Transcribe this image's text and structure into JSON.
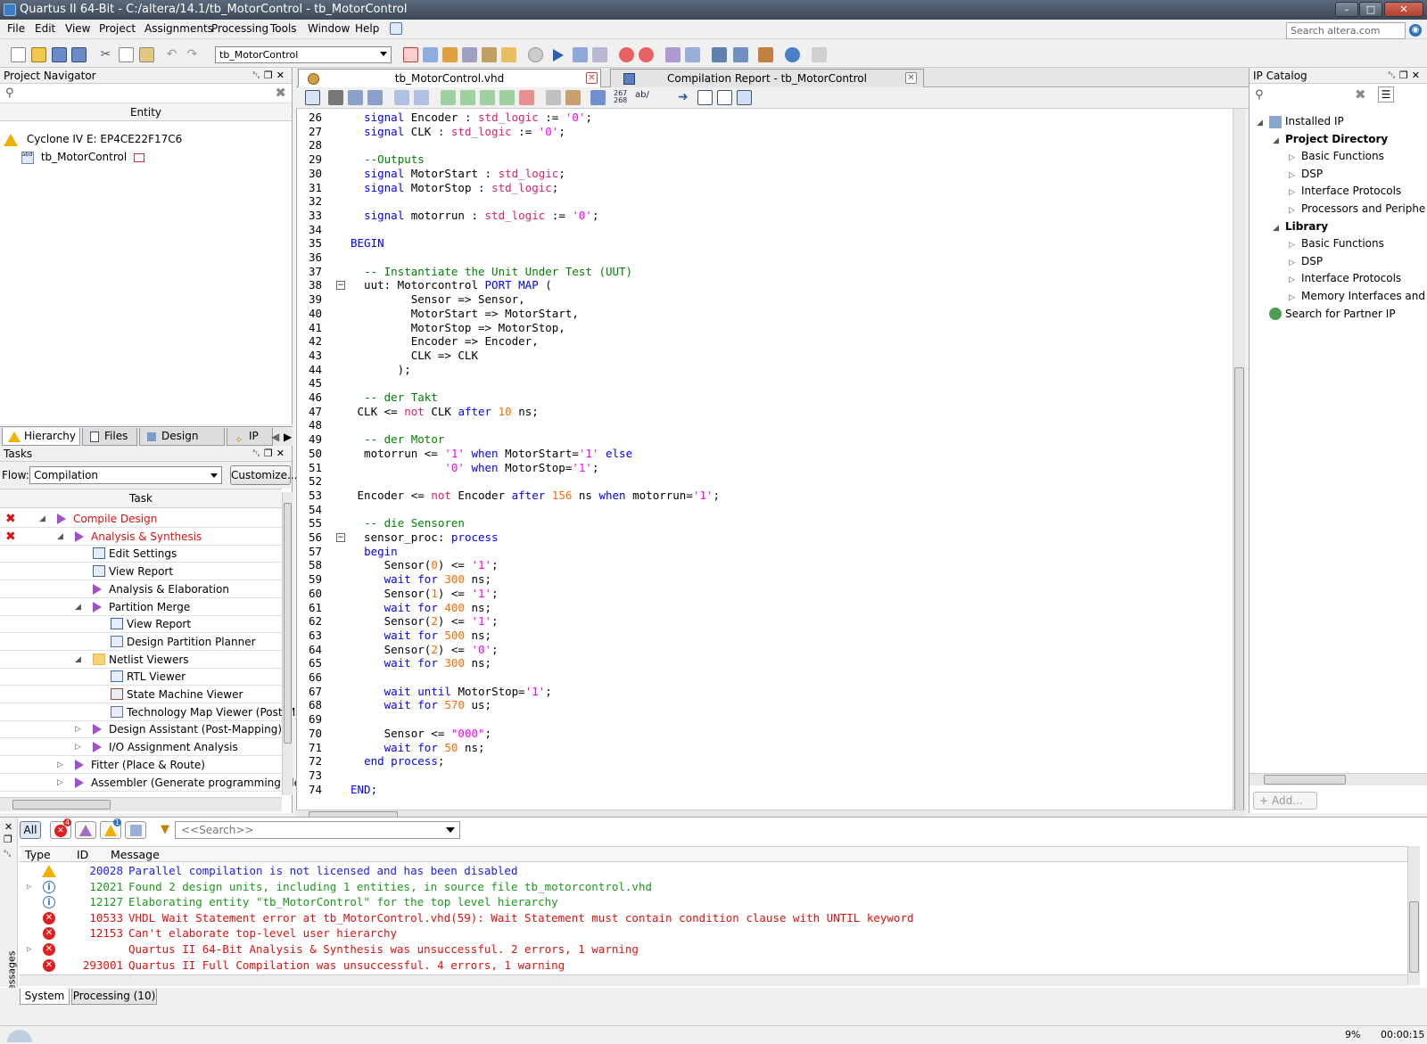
{
  "window": {
    "title": "Quartus II 64-Bit - C:/altera/14.1/tb_MotorControl - tb_MotorControl"
  },
  "menu": [
    "File",
    "Edit",
    "View",
    "Project",
    "Assignments",
    "Processing",
    "Tools",
    "Window",
    "Help"
  ],
  "web_search": {
    "placeholder": "Search altera.com"
  },
  "toolbar": {
    "entity_select": "tb_MotorControl"
  },
  "project_navigator": {
    "title": "Project Navigator",
    "column": "Entity",
    "device": "Cyclone IV E: EP4CE22F17C6",
    "entity": "tb_MotorControl",
    "tabs": [
      "Hierarchy",
      "Files",
      "Design Units",
      "IP"
    ]
  },
  "tasks": {
    "title": "Tasks",
    "flow_label": "Flow:",
    "flow_value": "Compilation",
    "customize": "Customize...",
    "column": "Task",
    "items": [
      {
        "label": "Compile Design",
        "level": 0,
        "status": "error",
        "icon": "play-icon",
        "expand": "open"
      },
      {
        "label": "Analysis & Synthesis",
        "level": 1,
        "status": "error",
        "icon": "play-icon",
        "expand": "open"
      },
      {
        "label": "Edit Settings",
        "level": 2,
        "status": "",
        "icon": "settings-icon",
        "expand": ""
      },
      {
        "label": "View Report",
        "level": 2,
        "status": "",
        "icon": "report-icon",
        "expand": ""
      },
      {
        "label": "Analysis & Elaboration",
        "level": 2,
        "status": "",
        "icon": "play-icon",
        "expand": ""
      },
      {
        "label": "Partition Merge",
        "level": 2,
        "status": "",
        "icon": "play-icon",
        "expand": "open"
      },
      {
        "label": "View Report",
        "level": 3,
        "status": "",
        "icon": "report-icon",
        "expand": ""
      },
      {
        "label": "Design Partition Planner",
        "level": 3,
        "status": "",
        "icon": "partition-icon",
        "expand": ""
      },
      {
        "label": "Netlist Viewers",
        "level": 2,
        "status": "",
        "icon": "folder-icon",
        "expand": "open"
      },
      {
        "label": "RTL Viewer",
        "level": 3,
        "status": "",
        "icon": "rtl-icon",
        "expand": ""
      },
      {
        "label": "State Machine Viewer",
        "level": 3,
        "status": "",
        "icon": "state-machine-icon",
        "expand": ""
      },
      {
        "label": "Technology Map Viewer (Post-Mappi",
        "level": 3,
        "status": "",
        "icon": "techmap-icon",
        "expand": ""
      },
      {
        "label": "Design Assistant (Post-Mapping)",
        "level": 2,
        "status": "",
        "icon": "play-icon",
        "expand": "closed"
      },
      {
        "label": "I/O Assignment Analysis",
        "level": 2,
        "status": "",
        "icon": "play-icon",
        "expand": "closed"
      },
      {
        "label": "Fitter (Place & Route)",
        "level": 1,
        "status": "",
        "icon": "play-icon",
        "expand": "closed"
      },
      {
        "label": "Assembler (Generate programming files)",
        "level": 1,
        "status": "",
        "icon": "play-icon",
        "expand": "closed"
      }
    ]
  },
  "editor": {
    "tabs": [
      {
        "label": "tb_MotorControl.vhd",
        "active": true
      },
      {
        "label": "Compilation Report - tb_MotorControl",
        "active": false
      }
    ],
    "lines": [
      {
        "n": "26",
        "t": "  signal Encoder : std_logic := '0';"
      },
      {
        "n": "27",
        "t": "  signal CLK : std_logic := '0';"
      },
      {
        "n": "28",
        "t": ""
      },
      {
        "n": "29",
        "t": "  --Outputs"
      },
      {
        "n": "30",
        "t": "  signal MotorStart : std_logic;"
      },
      {
        "n": "31",
        "t": "  signal MotorStop : std_logic;"
      },
      {
        "n": "32",
        "t": ""
      },
      {
        "n": "33",
        "t": "  signal motorrun : std_logic := '0';"
      },
      {
        "n": "34",
        "t": ""
      },
      {
        "n": "35",
        "t": "BEGIN"
      },
      {
        "n": "36",
        "t": ""
      },
      {
        "n": "37",
        "t": "  -- Instantiate the Unit Under Test (UUT)"
      },
      {
        "n": "38",
        "t": "  uut: Motorcontrol PORT MAP ("
      },
      {
        "n": "39",
        "t": "         Sensor => Sensor,"
      },
      {
        "n": "40",
        "t": "         MotorStart => MotorStart,"
      },
      {
        "n": "41",
        "t": "         MotorStop => MotorStop,"
      },
      {
        "n": "42",
        "t": "         Encoder => Encoder,"
      },
      {
        "n": "43",
        "t": "         CLK => CLK"
      },
      {
        "n": "44",
        "t": "       );"
      },
      {
        "n": "45",
        "t": ""
      },
      {
        "n": "46",
        "t": "  -- der Takt"
      },
      {
        "n": "47",
        "t": " CLK <= not CLK after 10 ns;"
      },
      {
        "n": "48",
        "t": ""
      },
      {
        "n": "49",
        "t": "  -- der Motor"
      },
      {
        "n": "50",
        "t": "  motorrun <= '1' when MotorStart='1' else"
      },
      {
        "n": "51",
        "t": "              '0' when MotorStop='1';"
      },
      {
        "n": "52",
        "t": ""
      },
      {
        "n": "53",
        "t": " Encoder <= not Encoder after 156 ns when motorrun='1';"
      },
      {
        "n": "54",
        "t": ""
      },
      {
        "n": "55",
        "t": "  -- die Sensoren"
      },
      {
        "n": "56",
        "t": "  sensor_proc: process"
      },
      {
        "n": "57",
        "t": "  begin"
      },
      {
        "n": "58",
        "t": "     Sensor(0) <= '1';"
      },
      {
        "n": "59",
        "t": "     wait for 300 ns;"
      },
      {
        "n": "60",
        "t": "     Sensor(1) <= '1';"
      },
      {
        "n": "61",
        "t": "     wait for 400 ns;"
      },
      {
        "n": "62",
        "t": "     Sensor(2) <= '1';"
      },
      {
        "n": "63",
        "t": "     wait for 500 ns;"
      },
      {
        "n": "64",
        "t": "     Sensor(2) <= '0';"
      },
      {
        "n": "65",
        "t": "     wait for 300 ns;"
      },
      {
        "n": "66",
        "t": ""
      },
      {
        "n": "67",
        "t": "     wait until MotorStop='1';"
      },
      {
        "n": "68",
        "t": "     wait for 570 us;"
      },
      {
        "n": "69",
        "t": ""
      },
      {
        "n": "70",
        "t": "     Sensor <= \"000\";"
      },
      {
        "n": "71",
        "t": "     wait for 50 ns;"
      },
      {
        "n": "72",
        "t": "  end process;"
      },
      {
        "n": "73",
        "t": ""
      },
      {
        "n": "74",
        "t": "END;"
      }
    ]
  },
  "ip_catalog": {
    "title": "IP Catalog",
    "items": [
      {
        "label": "Installed IP",
        "level": 0,
        "bold": false
      },
      {
        "label": "Project Directory",
        "level": 1,
        "bold": true
      },
      {
        "label": "Basic Functions",
        "level": 2,
        "bold": false
      },
      {
        "label": "DSP",
        "level": 2,
        "bold": false
      },
      {
        "label": "Interface Protocols",
        "level": 2,
        "bold": false
      },
      {
        "label": "Processors and Periphe",
        "level": 2,
        "bold": false
      },
      {
        "label": "Library",
        "level": 1,
        "bold": true
      },
      {
        "label": "Basic Functions",
        "level": 2,
        "bold": false
      },
      {
        "label": "DSP",
        "level": 2,
        "bold": false
      },
      {
        "label": "Interface Protocols",
        "level": 2,
        "bold": false
      },
      {
        "label": "Memory Interfaces and",
        "level": 2,
        "bold": false
      },
      {
        "label": "Search for Partner IP",
        "level": 0,
        "bold": false
      }
    ],
    "add_button": "Add..."
  },
  "messages": {
    "filter_all": "All",
    "error_count": "4",
    "info_count": "1",
    "search_placeholder": "<<Search>>",
    "columns": [
      "Type",
      "ID",
      "Message"
    ],
    "rows": [
      {
        "type": "warning",
        "id": "20028",
        "text": "Parallel compilation is not licensed and has been disabled",
        "color": "#1a1aff"
      },
      {
        "type": "info",
        "id": "12021",
        "text": "Found 2 design units, including 1 entities, in source file tb_motorcontrol.vhd",
        "color": "#1a9a1a"
      },
      {
        "type": "info",
        "id": "12127",
        "text": "Elaborating entity \"tb_MotorControl\" for the top level hierarchy",
        "color": "#1a9a1a"
      },
      {
        "type": "error",
        "id": "10533",
        "text": "VHDL Wait Statement error at tb_MotorControl.vhd(59): Wait Statement must contain condition clause with UNTIL keyword",
        "color": "#e01010"
      },
      {
        "type": "error",
        "id": "12153",
        "text": "Can't elaborate top-level user hierarchy",
        "color": "#e01010"
      },
      {
        "type": "error",
        "id": "",
        "text": "Quartus II 64-Bit Analysis & Synthesis was unsuccessful. 2 errors, 1 warning",
        "color": "#e01010"
      },
      {
        "type": "error",
        "id": "293001",
        "text": "Quartus II Full Compilation was unsuccessful. 4 errors, 1 warning",
        "color": "#e01010"
      }
    ],
    "side_label": "Messages",
    "tabs": [
      "System",
      "Processing (10)"
    ]
  },
  "status": {
    "progress": "9%",
    "time": "00:00:15"
  }
}
